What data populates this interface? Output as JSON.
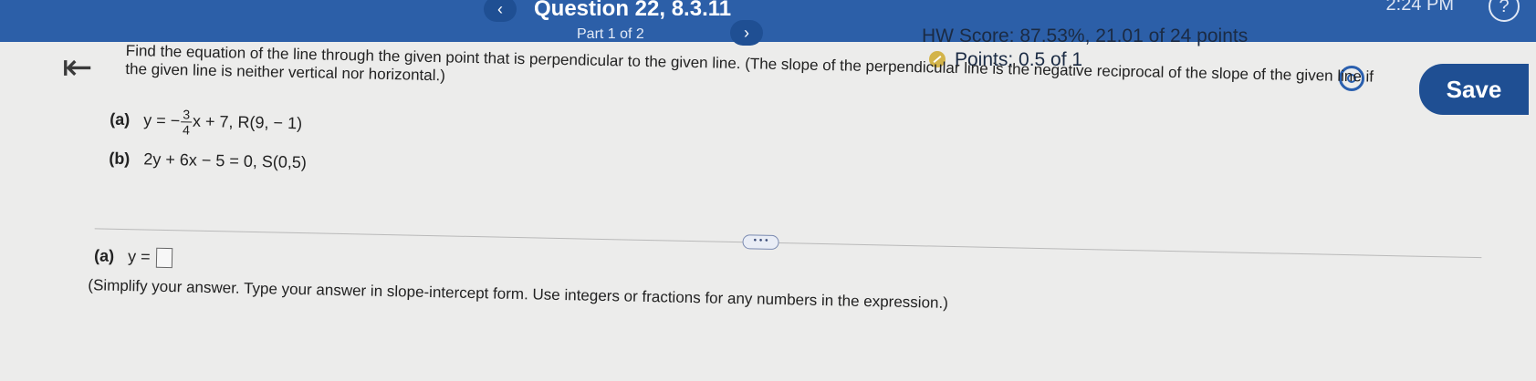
{
  "header": {
    "time": "2:24 PM",
    "help_label": "?",
    "prev_label": "‹",
    "next_label": "›",
    "question_title": "Question 22, 8.3.11",
    "part_label": "Part 1 of 2",
    "hw_score": "HW Score: 87.53%, 21.01 of 24 points",
    "points": "Points: 0.5 of 1",
    "save_label": "Save"
  },
  "nav": {
    "back_icon": "⇤"
  },
  "question": {
    "prompt_line1": "Find the equation of the line through the given point that is perpendicular to the given line. (The slope of the perpendicular line is the negative reciprocal of the slope of the given line if",
    "prompt_line2": "the given line is neither vertical nor horizontal.)",
    "a_label": "(a)",
    "a_eq_start": "y = −",
    "a_frac_num": "3",
    "a_frac_den": "4",
    "a_eq_end": "x + 7, R(9, − 1)",
    "b_label": "(b)",
    "b_eq": "2y + 6x − 5 = 0, S(0,5)"
  },
  "more_label": "• • •",
  "answer": {
    "label": "(a)",
    "prefix": "y =",
    "instructions": "(Simplify your answer. Type your answer in slope-intercept form. Use integers or fractions for any numbers in the expression.)"
  }
}
